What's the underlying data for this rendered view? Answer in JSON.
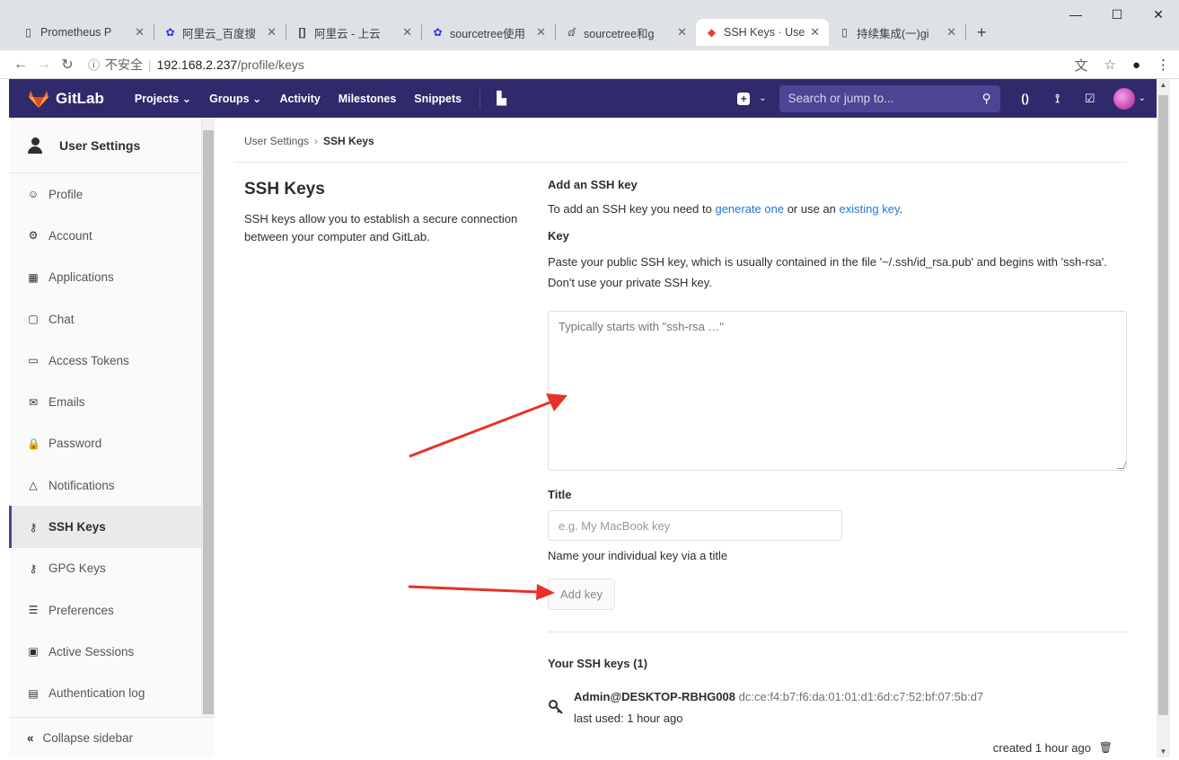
{
  "browser": {
    "tabs": [
      {
        "title": "Prometheus P",
        "icon": "page-icon"
      },
      {
        "title": "阿里云_百度搜",
        "icon": "baidu-icon"
      },
      {
        "title": "阿里云 - 上云",
        "icon": "aliyun-icon"
      },
      {
        "title": "sourcetree使用",
        "icon": "baidu-icon"
      },
      {
        "title": "sourcetree和g",
        "icon": "feather-icon"
      },
      {
        "title": "SSH Keys · Use",
        "icon": "gitlab-icon",
        "active": true
      },
      {
        "title": "持续集成(一)gi",
        "icon": "page-icon"
      }
    ],
    "address": {
      "info": "ⓘ",
      "insecure": "不安全",
      "host": "192.168.2.237",
      "path": "/profile/keys"
    }
  },
  "navbar": {
    "brand": "GitLab",
    "menu": [
      "Projects ⌄",
      "Groups ⌄",
      "Activity",
      "Milestones",
      "Snippets"
    ],
    "search_placeholder": "Search or jump to..."
  },
  "sidebar": {
    "title": "User Settings",
    "items": [
      {
        "label": "Profile",
        "icon": "profile-icon",
        "glyph": "☺"
      },
      {
        "label": "Account",
        "icon": "account-icon",
        "glyph": "⚙"
      },
      {
        "label": "Applications",
        "icon": "applications-icon",
        "glyph": "▦"
      },
      {
        "label": "Chat",
        "icon": "chat-icon",
        "glyph": "▢"
      },
      {
        "label": "Access Tokens",
        "icon": "token-icon",
        "glyph": "▭"
      },
      {
        "label": "Emails",
        "icon": "email-icon",
        "glyph": "✉"
      },
      {
        "label": "Password",
        "icon": "lock-icon",
        "glyph": "🔒"
      },
      {
        "label": "Notifications",
        "icon": "bell-icon",
        "glyph": "△"
      },
      {
        "label": "SSH Keys",
        "icon": "key-icon",
        "glyph": "⚷",
        "active": true
      },
      {
        "label": "GPG Keys",
        "icon": "key-icon",
        "glyph": "⚷"
      },
      {
        "label": "Preferences",
        "icon": "sliders-icon",
        "glyph": "☰"
      },
      {
        "label": "Active Sessions",
        "icon": "monitor-icon",
        "glyph": "▣"
      },
      {
        "label": "Authentication log",
        "icon": "log-icon",
        "glyph": "▤"
      }
    ],
    "collapse_label": "Collapse sidebar"
  },
  "breadcrumb": {
    "parent": "User Settings",
    "current": "SSH Keys"
  },
  "intro": {
    "title": "SSH Keys",
    "description": "SSH keys allow you to establish a secure connection between your computer and GitLab."
  },
  "form": {
    "heading": "Add an SSH key",
    "lead_before": "To add an SSH key you need to ",
    "lead_link1": "generate one",
    "lead_middle": " or use an ",
    "lead_link2": "existing key",
    "lead_after": ".",
    "key_label": "Key",
    "key_help": "Paste your public SSH key, which is usually contained in the file '~/.ssh/id_rsa.pub' and begins with 'ssh-rsa'. Don't use your private SSH key.",
    "key_placeholder": "Typically starts with \"ssh-rsa …\"",
    "title_label": "Title",
    "title_placeholder": "e.g. My MacBook key",
    "title_help": "Name your individual key via a title",
    "submit_label": "Add key"
  },
  "keys_list": {
    "heading": "Your SSH keys (1)",
    "items": [
      {
        "title": "Admin@DESKTOP-RBHG008",
        "fingerprint": "dc:ce:f4:b7:f6:da:01:01:d1:6d:c7:52:bf:07:5b:d7",
        "last_used": "last used: 1 hour ago",
        "created": "created 1 hour ago"
      }
    ]
  },
  "colors": {
    "navbar_bg": "#2f2a6b",
    "link": "#1f78d1",
    "annotation_arrow": "#e8312a"
  }
}
